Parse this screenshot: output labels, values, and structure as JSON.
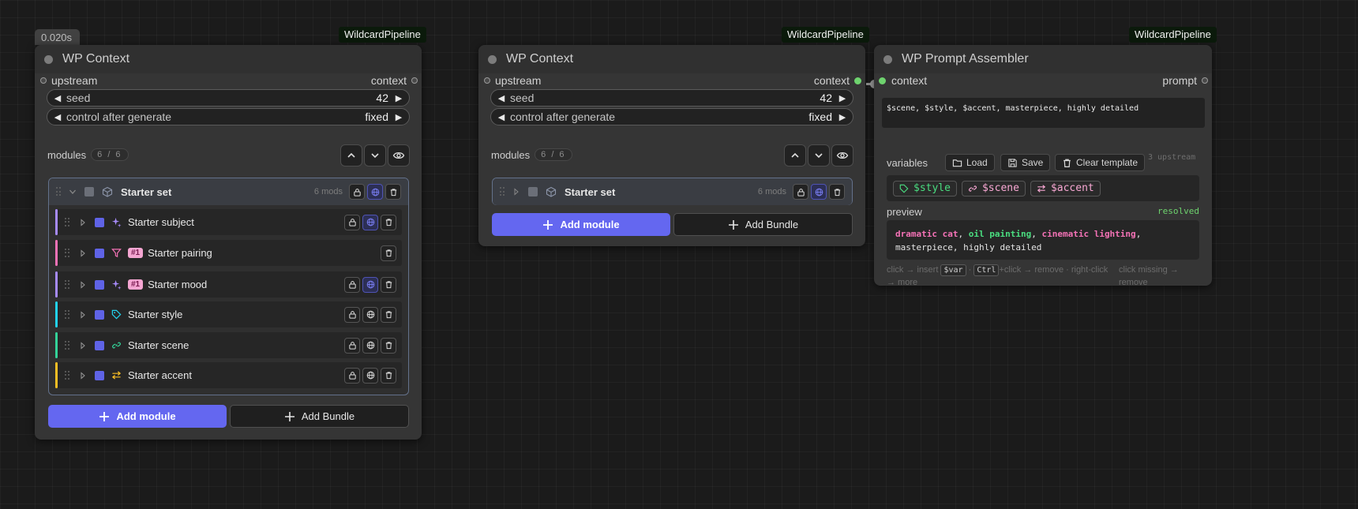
{
  "node1": {
    "timer": "0.020s",
    "badge": "WildcardPipeline",
    "title": "WP Context",
    "input": "upstream",
    "output": "context",
    "seed": {
      "label": "seed",
      "value": "42"
    },
    "control": {
      "label": "control after generate",
      "value": "fixed"
    },
    "modules_label": "modules",
    "modules_count": "6 / 6",
    "set": {
      "name": "Starter set",
      "count": "6 mods"
    },
    "items": [
      {
        "name": "Starter subject",
        "color": "#a78bfa",
        "icon": "sparkles-icon",
        "tag": "",
        "global": true
      },
      {
        "name": "Starter pairing",
        "color": "#f472b6",
        "icon": "filter-icon",
        "tag": "#1",
        "global": false
      },
      {
        "name": "Starter mood",
        "color": "#a78bfa",
        "icon": "sparkles-icon",
        "tag": "#1",
        "global": true
      },
      {
        "name": "Starter style",
        "color": "#22d3ee",
        "icon": "tag-icon",
        "tag": "",
        "global": false
      },
      {
        "name": "Starter scene",
        "color": "#34d399",
        "icon": "link-icon",
        "tag": "",
        "global": false
      },
      {
        "name": "Starter accent",
        "color": "#fbbf24",
        "icon": "swap-icon",
        "tag": "",
        "global": false
      }
    ],
    "add_module": "Add module",
    "add_bundle": "Add Bundle"
  },
  "node2": {
    "badge": "WildcardPipeline",
    "title": "WP Context",
    "input": "upstream",
    "output": "context",
    "seed": {
      "label": "seed",
      "value": "42"
    },
    "control": {
      "label": "control after generate",
      "value": "fixed"
    },
    "modules_label": "modules",
    "modules_count": "6 / 6",
    "set": {
      "name": "Starter set",
      "count": "6 mods"
    },
    "add_module": "Add module",
    "add_bundle": "Add Bundle"
  },
  "node3": {
    "badge": "WildcardPipeline",
    "title": "WP Prompt Assembler",
    "input": "context",
    "output": "prompt",
    "template": "$scene, $style, $accent, masterpiece, highly detailed",
    "variables_label": "variables",
    "load": "Load",
    "save": "Save",
    "clear": "Clear template",
    "upstream_note": "3 upstream",
    "chips": [
      {
        "label": "$style",
        "color": "#4ade80",
        "icon": "tag-icon"
      },
      {
        "label": "$scene",
        "color": "#f9a8d4",
        "icon": "link-icon"
      },
      {
        "label": "$accent",
        "color": "#f9a8d4",
        "icon": "swap-icon"
      }
    ],
    "preview_label": "preview",
    "resolved": "resolved",
    "preview": {
      "p1": "dramatic cat",
      "s1": ", ",
      "p2": "oil painting",
      "s2": ", ",
      "p3": "cinematic lighting",
      "s3": ",",
      "line2": "masterpiece, highly detailed"
    },
    "hint": {
      "a": "click → insert",
      "var": "$var",
      "b": "·",
      "ctrl": "Ctrl",
      "c": "+click → remove · right-click → more",
      "right": "click missing → remove"
    }
  },
  "colors": {
    "accent": "#6467f0",
    "connected": "#6ed36e",
    "badge_bg": "#0b1a0b"
  }
}
